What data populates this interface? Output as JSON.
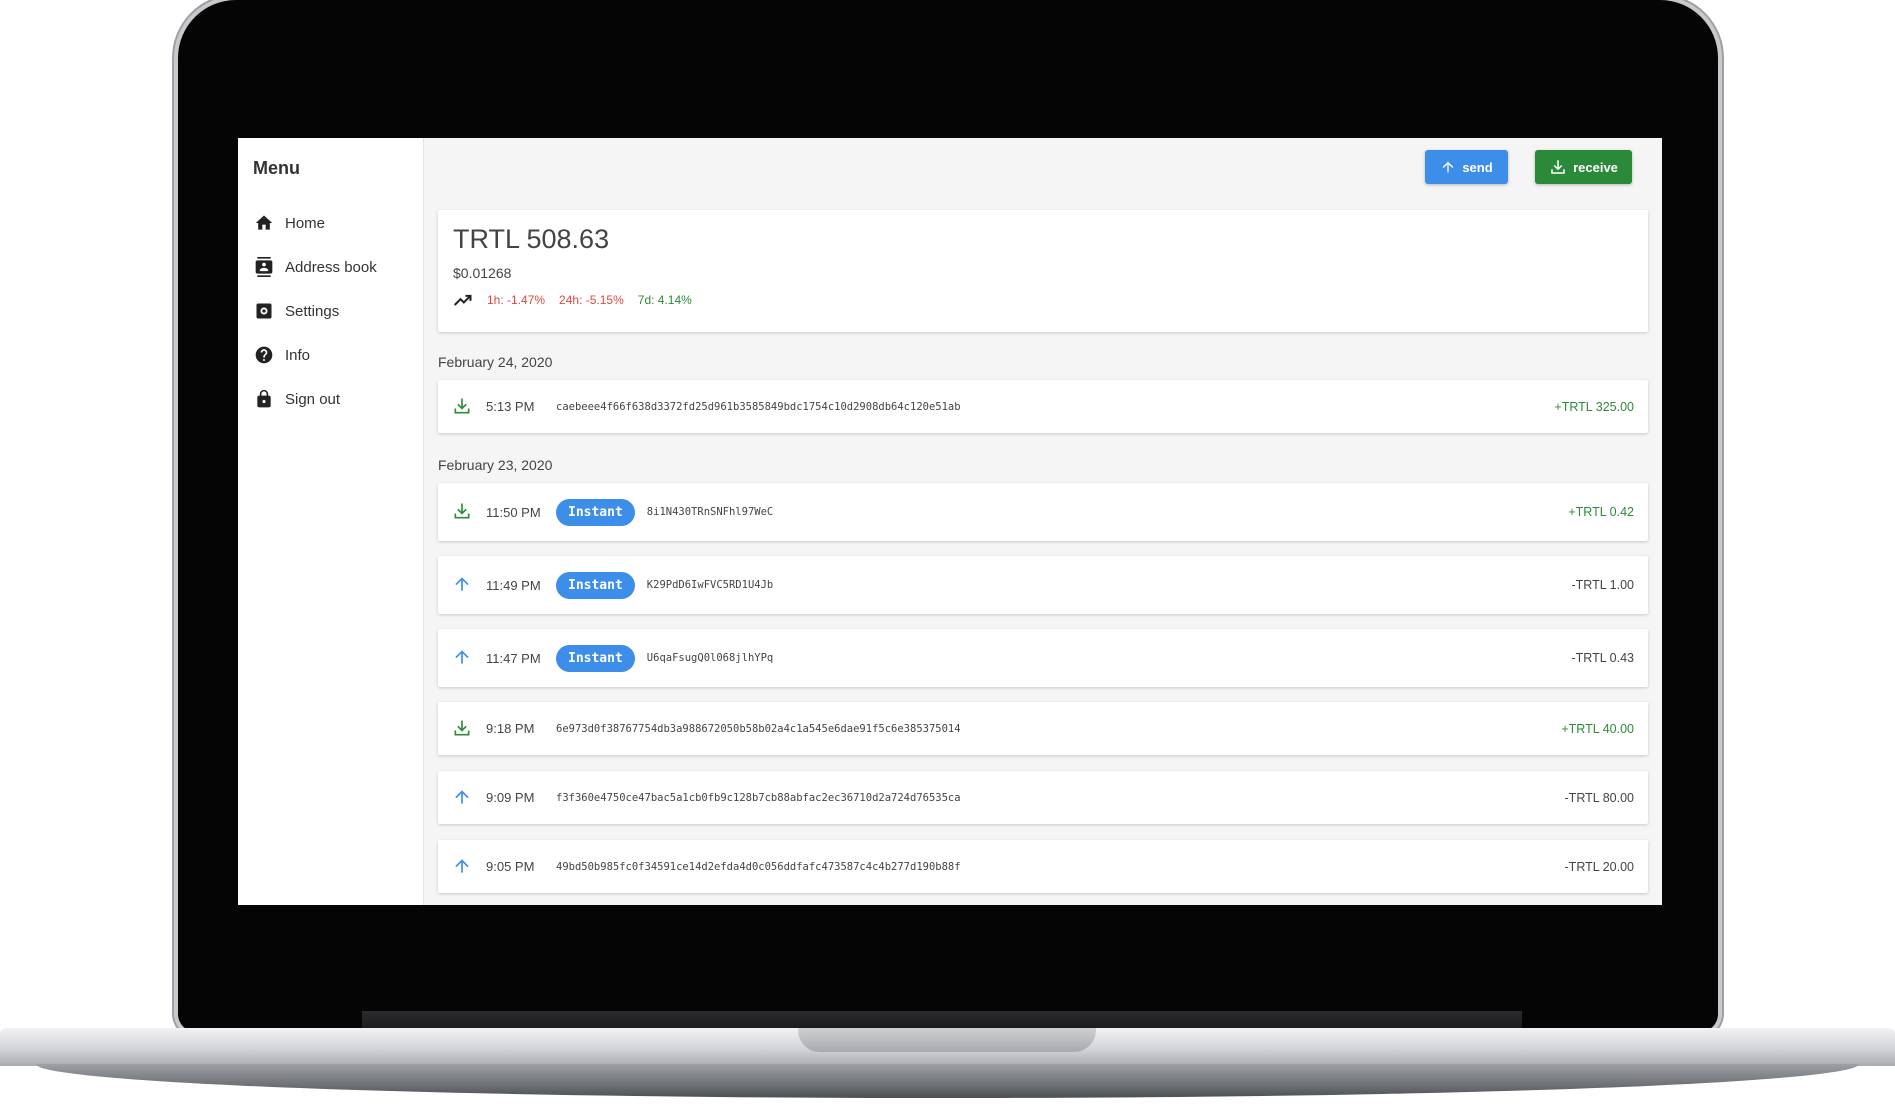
{
  "menu": {
    "title": "Menu",
    "items": [
      {
        "label": "Home",
        "icon": "home-icon"
      },
      {
        "label": "Address book",
        "icon": "contacts-icon"
      },
      {
        "label": "Settings",
        "icon": "gear-icon"
      },
      {
        "label": "Info",
        "icon": "help-icon"
      },
      {
        "label": "Sign out",
        "icon": "lock-icon"
      }
    ]
  },
  "toolbar": {
    "send_label": "send",
    "receive_label": "receive"
  },
  "wallet": {
    "balance": "TRTL 508.63",
    "usd_price": "$0.01268",
    "change_1h": "1h: -1.47%",
    "change_24h": "24h: -5.15%",
    "change_7d": "7d: 4.14%"
  },
  "colors": {
    "accent_blue": "#3d8ee8",
    "accent_green": "#2a8a3a",
    "negative": "#e0473c",
    "positive": "#2e8b3a"
  },
  "days": [
    {
      "date": "February 24, 2020",
      "transactions": [
        {
          "direction": "in",
          "time": "5:13 PM",
          "badge": "",
          "hash": "caebeee4f66f638d3372fd25d961b3585849bdc1754c10d2908db64c120e51ab",
          "amount": "+TRTL 325.00"
        }
      ]
    },
    {
      "date": "February 23, 2020",
      "transactions": [
        {
          "direction": "in",
          "time": "11:50 PM",
          "badge": "Instant",
          "hash": "8i1N430TRnSNFhl97WeC",
          "amount": "+TRTL 0.42"
        },
        {
          "direction": "out",
          "time": "11:49 PM",
          "badge": "Instant",
          "hash": "K29PdD6IwFVC5RD1U4Jb",
          "amount": "-TRTL 1.00"
        },
        {
          "direction": "out",
          "time": "11:47 PM",
          "badge": "Instant",
          "hash": "U6qaFsugQ0l068jlhYPq",
          "amount": "-TRTL 0.43"
        },
        {
          "direction": "in",
          "time": "9:18 PM",
          "badge": "",
          "hash": "6e973d0f38767754db3a988672050b58b02a4c1a545e6dae91f5c6e385375014",
          "amount": "+TRTL 40.00"
        },
        {
          "direction": "out",
          "time": "9:09 PM",
          "badge": "",
          "hash": "f3f360e4750ce47bac5a1cb0fb9c128b7cb88abfac2ec36710d2a724d76535ca",
          "amount": "-TRTL 80.00"
        },
        {
          "direction": "out",
          "time": "9:05 PM",
          "badge": "",
          "hash": "49bd50b985fc0f34591ce14d2efda4d0c056ddfafc473587c4c4b277d190b88f",
          "amount": "-TRTL 20.00"
        }
      ]
    }
  ]
}
